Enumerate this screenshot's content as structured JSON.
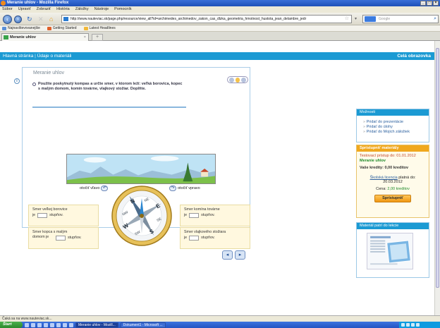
{
  "window": {
    "title": "Meranie uhlov - Mozilla Firefox"
  },
  "menu": [
    "Súbor",
    "Upraviť",
    "Zobraziť",
    "História",
    "Záložky",
    "Nástroje",
    "Pomocník"
  ],
  "urlbar": {
    "value": "http://www.nauteviac.sk/page.php/resource/view_all?id=archimedes_archimedov_zakon_cas_dlzka_geometria_hmotnost_hustota_jean_delambre_jedr"
  },
  "search": {
    "placeholder": "Google"
  },
  "bookmarks": [
    "Najnavštevovanejšie",
    "Getting Started",
    "Latest Headlines"
  ],
  "tab": {
    "label": "Meranie uhlov"
  },
  "sitenav": {
    "home": "Hlavná stránka",
    "separator": "|",
    "current": "Údaje o materiáli",
    "fullscreen": "Celá obrazovka"
  },
  "lesson": {
    "title": "Meranie uhlov",
    "instruction": "Použite poskytnutý kompas a určte smer, v ktorom leží: veľká borovica, kopec s malým domom, komín továrne, vlajkový stožiar. Doplňte.",
    "rotate_left": "otočiť vľavo",
    "rotate_right": "otočiť vpravo",
    "answers": [
      {
        "label": "Smer veľkej borovice",
        "prefix": "je",
        "suffix": "stupňov."
      },
      {
        "label": "Smer kopca s malým domom je",
        "prefix": "",
        "suffix": "stupňov."
      },
      {
        "label": "Smer komína továrne",
        "prefix": "je",
        "suffix": "stupňov."
      },
      {
        "label": "Smer vlajkového stožiara",
        "prefix": "je",
        "suffix": "stupňov."
      }
    ]
  },
  "options": {
    "title": "Možnosti",
    "items": [
      "Pridať do prezentácie",
      "Pridať do úlohy",
      "Pridať do Mojich záložiek"
    ]
  },
  "purchase": {
    "title": "Sprístupniť materiály",
    "trial": "Testovací prístup do: 01.01.2012",
    "material": "Meranie uhlov",
    "credits": "Vaše kredity: 0,00 kreditov",
    "license_link": "Školská licencia",
    "license_text": "platná do:",
    "license_date": "20.03.2012",
    "price_label": "Cena:",
    "price_value": "2,00 kreditov",
    "button": "Sprístupniť"
  },
  "related": {
    "title": "Materiál patrí do lekcie"
  },
  "status": {
    "text": "Čaká sa na www.nauteviac.sk..."
  },
  "taskbar": {
    "start": "Štart",
    "tasks": [
      "Meranie uhlov - Mozill...",
      "Dokument1 - Microsoft ..."
    ]
  },
  "colors": {
    "accent": "#1b9ad3",
    "purchase": "#f0a81e",
    "answer_bg": "#fff8df"
  }
}
